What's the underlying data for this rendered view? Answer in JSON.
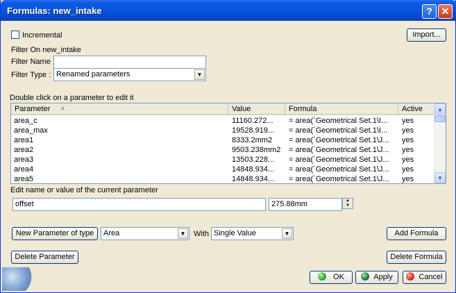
{
  "window": {
    "title": "Formulas: new_intake"
  },
  "titlebar": {
    "help_glyph": "?",
    "close_glyph": "✕"
  },
  "options": {
    "incremental_label": "Incremental",
    "import_label": "Import..."
  },
  "filter": {
    "section_label": "Filter On new_intake",
    "name_label": "Filter Name :",
    "name_value": "",
    "type_label": "Filter Type :",
    "type_value": "Renamed parameters"
  },
  "list": {
    "hint": "Double click on a parameter to edit it",
    "columns": [
      "Parameter",
      "Value",
      "Formula",
      "Active"
    ],
    "rows": [
      {
        "parameter": "area_c",
        "value": "11160.272...",
        "formula": "= area(`Geometrical Set.1\\I...",
        "active": "yes"
      },
      {
        "parameter": "area_max",
        "value": "19528.919...",
        "formula": "= area(`Geometrical Set.1\\I...",
        "active": "yes"
      },
      {
        "parameter": "area1",
        "value": "8333.2mm2",
        "formula": "= area(`Geometrical Set.1\\J...",
        "active": "yes"
      },
      {
        "parameter": "area2",
        "value": "9503.238mm2",
        "formula": "= area(`Geometrical Set.1\\J...",
        "active": "yes"
      },
      {
        "parameter": "area3",
        "value": "13503.228...",
        "formula": "= area(`Geometrical Set.1\\J...",
        "active": "yes"
      },
      {
        "parameter": "area4",
        "value": "14848.934...",
        "formula": "= area(`Geometrical Set.1\\J...",
        "active": "yes"
      },
      {
        "parameter": "area5",
        "value": "14848.934...",
        "formula": "= area(`Geometrical Set.1\\J...",
        "active": "yes"
      }
    ]
  },
  "edit": {
    "label": "Edit name or value of the current parameter",
    "name_value": "offset",
    "value_value": "275.88mm"
  },
  "new_param": {
    "button_label": "New Parameter of type",
    "type_value": "Area",
    "with_label": "With",
    "with_value": "Single Value",
    "add_formula_label": "Add Formula"
  },
  "actions": {
    "delete_parameter_label": "Delete Parameter",
    "delete_formula_label": "Delete Formula",
    "ok_label": "OK",
    "apply_label": "Apply",
    "cancel_label": "Cancel"
  },
  "colors": {
    "titlebar": "#0855dd",
    "dialog_bg": "#efe9d6",
    "ok_icon": "#2faa3a",
    "apply_icon": "#1e7a3a",
    "cancel_icon": "#d8321f"
  },
  "icons": {
    "sort": "sort-up-icon",
    "combo_arrow": "chevron-down-icon",
    "spinner": "spinner-icon"
  }
}
